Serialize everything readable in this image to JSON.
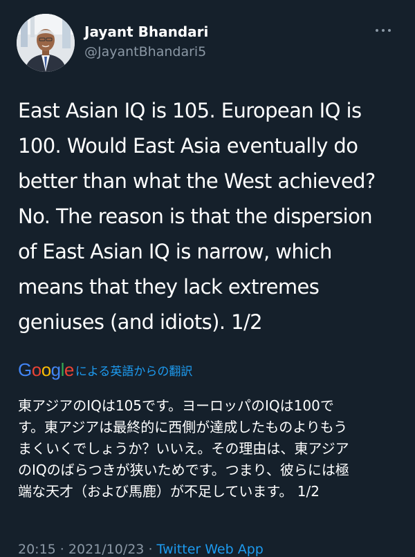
{
  "author": {
    "name": "Jayant Bhandari",
    "handle": "@JayantBhandari5"
  },
  "tweet": {
    "lines": [
      "East Asian IQ is 105. European IQ is",
      "100. Would East Asia eventually do",
      "better than what the West achieved?",
      "No. The reason is that the dispersion",
      "of East Asian IQ is narrow, which",
      "means that they lack extremes",
      "geniuses (and idiots). 1/2"
    ]
  },
  "translation": {
    "google_logo": "Google",
    "label": "による英語からの翻訳",
    "lines": [
      "東アジアのIQは105です。ヨーロッパのIQは100で",
      "す。東アジアは最終的に西側が達成したものよりもう",
      "まくいくでしょうか？いいえ。その理由は、東アジア",
      "のIQのばらつきが狭いためです。つまり、彼らには極",
      "端な天才（および馬鹿）が不足しています。 1/2"
    ]
  },
  "meta": {
    "time": "20:15",
    "separator": " · ",
    "date": "2021/10/23",
    "source": "Twitter Web App"
  },
  "colors": {
    "background": "#15202b",
    "text": "#ffffff",
    "muted": "#8b98a5",
    "link": "#1d9bf0"
  },
  "icons": {
    "more": "more-horizontal-icon",
    "avatar": "profile-photo"
  }
}
